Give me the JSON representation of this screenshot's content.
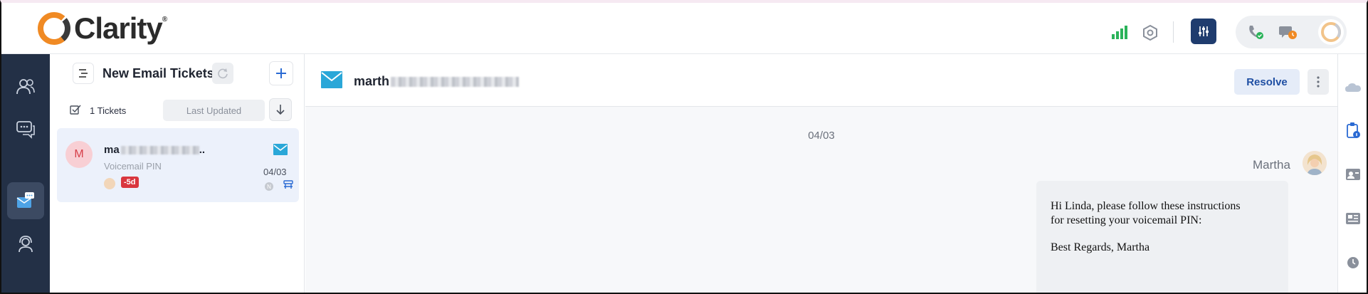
{
  "app": {
    "logo_text": "Clarity",
    "logo_mark": "®"
  },
  "header": {
    "icons": [
      "signal-bars-icon",
      "hexagon-settings-icon",
      "sliders-icon",
      "phone-status-icon",
      "chat-status-icon",
      "agent-avatar"
    ]
  },
  "nav": {
    "items": [
      {
        "name": "contacts",
        "icon": "contacts-icon"
      },
      {
        "name": "chats",
        "icon": "chat-bubbles-icon"
      },
      {
        "name": "email",
        "icon": "email-chat-icon",
        "active": true
      },
      {
        "name": "support",
        "icon": "headset-icon"
      }
    ]
  },
  "ticket_list": {
    "title": "New Email Tickets",
    "count_label": "1 Tickets",
    "sort_label": "Last Updated",
    "tickets": [
      {
        "avatar_initial": "M",
        "name_prefix": "ma",
        "name_suffix": "..",
        "subject": "Voicemail PIN",
        "date": "04/03",
        "badge": "-5d",
        "status_initial": "N"
      }
    ]
  },
  "conversation": {
    "email_prefix": "marth",
    "resolve_label": "Resolve",
    "date_separator": "04/03",
    "sender_name": "Martha",
    "message": {
      "line1": "Hi Linda, please follow these instructions",
      "line2": "for resetting your voicemail PIN:",
      "signoff": "Best Regards, Martha"
    }
  },
  "colors": {
    "nav_bg": "#233046",
    "accent_blue": "#1f3c6e",
    "mail_blue": "#2aa7d8",
    "badge_red": "#d9363e",
    "signal_green": "#2bb35a",
    "logo_orange": "#f08a24"
  }
}
